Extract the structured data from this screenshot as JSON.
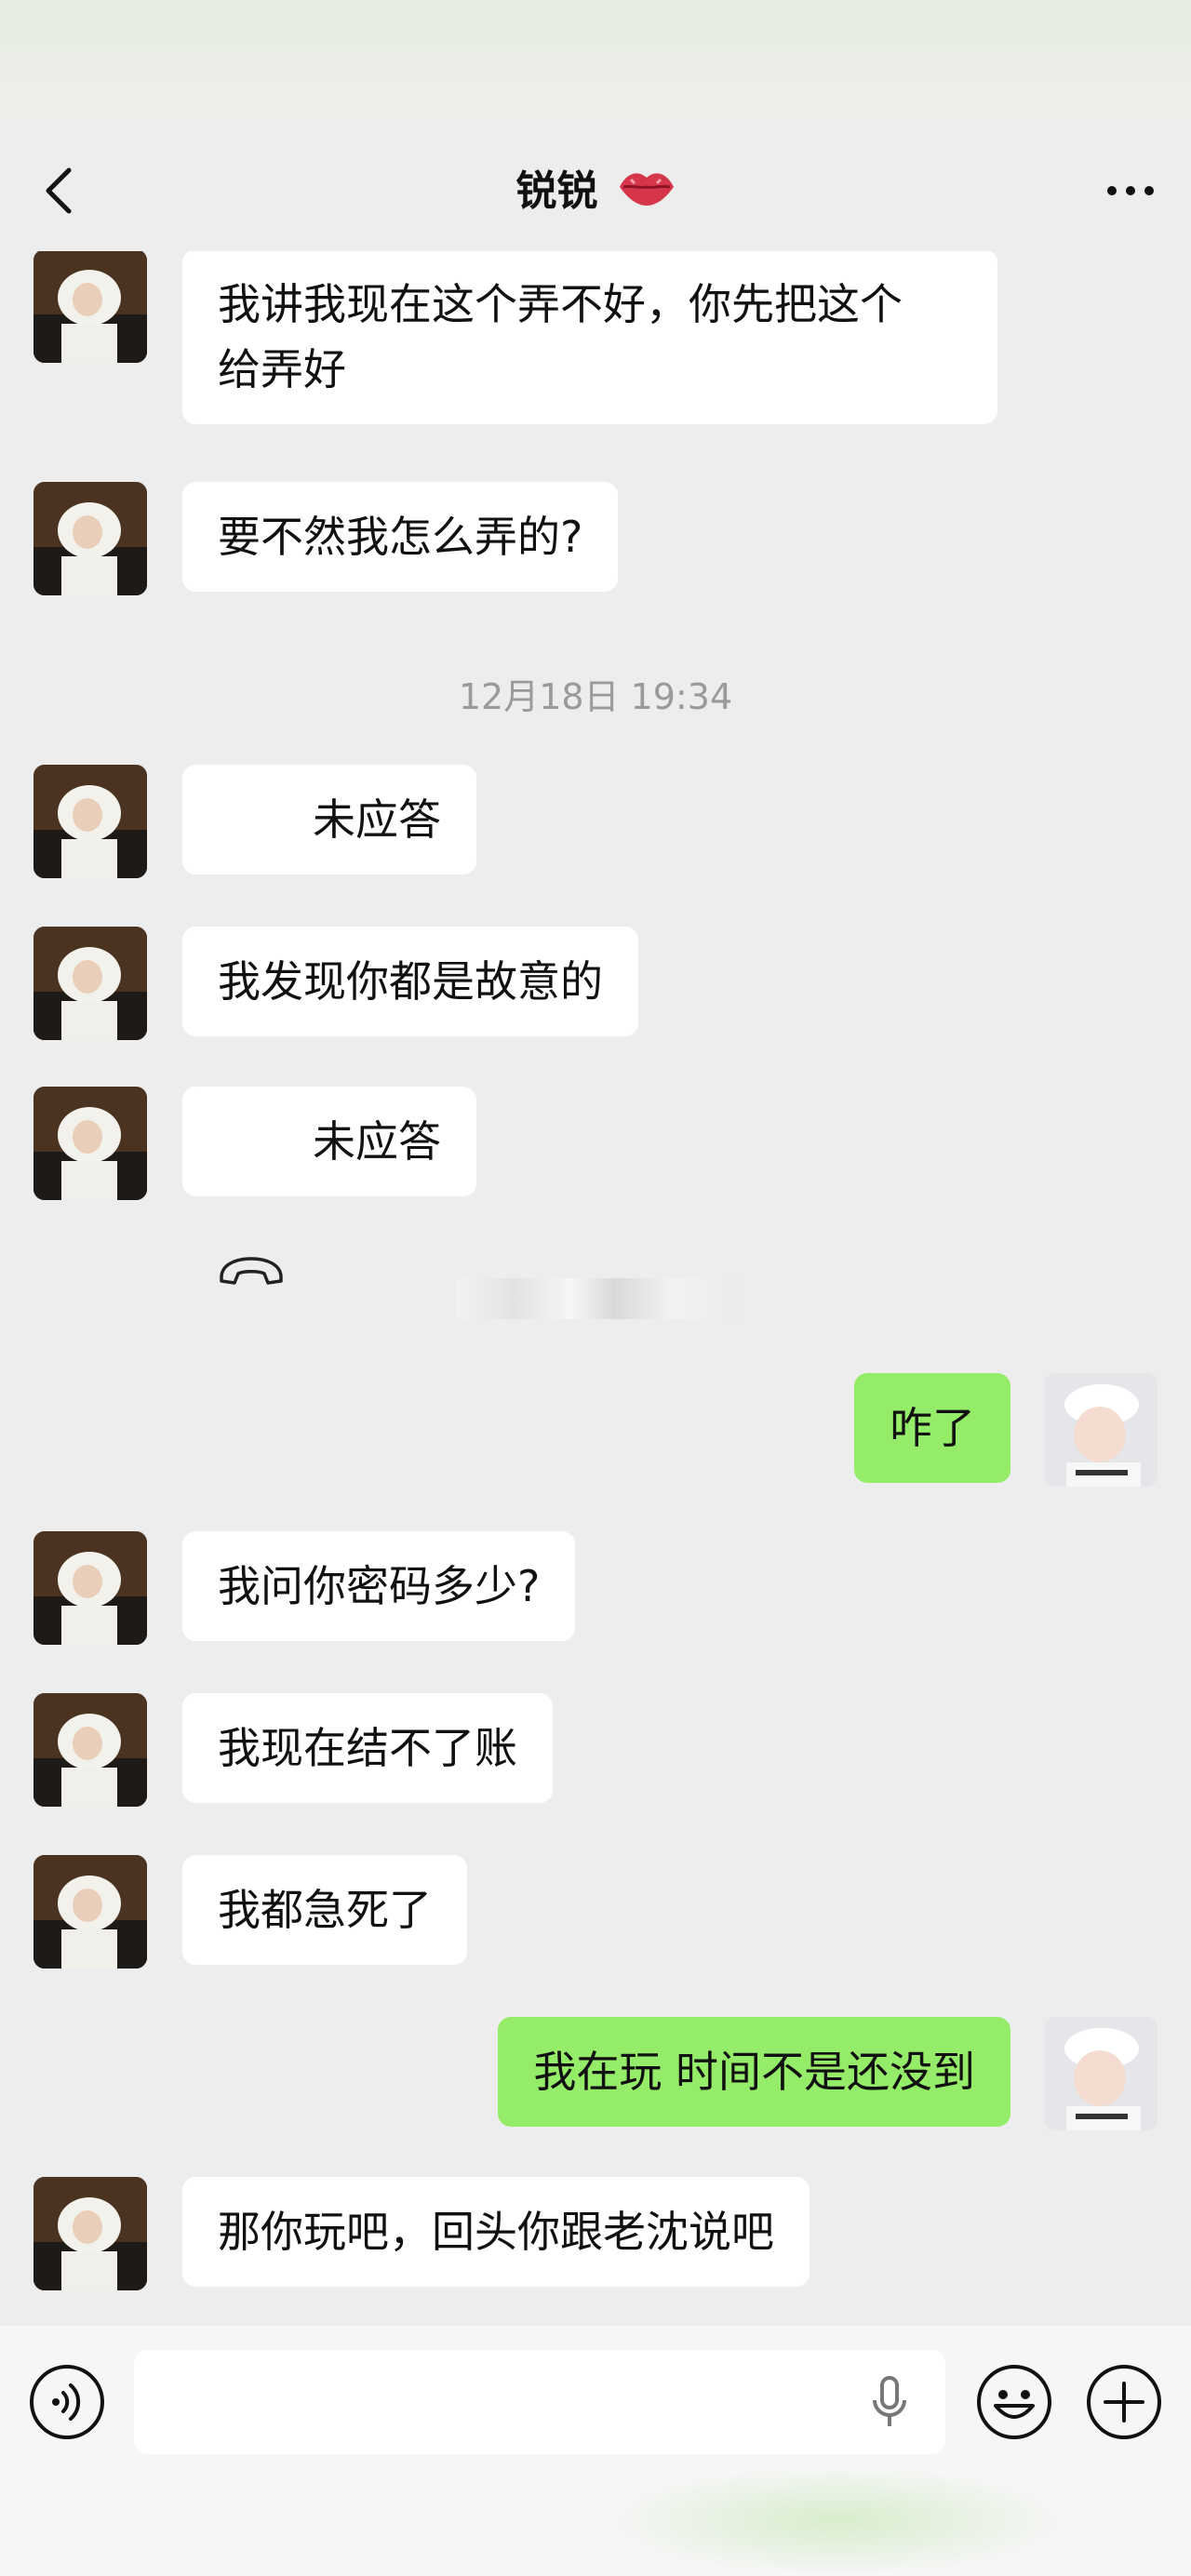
{
  "header": {
    "title": "锐锐"
  },
  "messages": [
    {
      "side": "left",
      "type": "text",
      "text": "我讲我现在这个弄不好，你先把这个\n给弄好"
    },
    {
      "side": "left",
      "type": "text",
      "text": "要不然我怎么弄的?"
    },
    {
      "type": "timestamp",
      "text": "12月18日 19:34"
    },
    {
      "side": "left",
      "type": "call",
      "text": "未应答"
    },
    {
      "side": "left",
      "type": "text",
      "text": "我发现你都是故意的"
    },
    {
      "side": "left",
      "type": "call",
      "text": "未应答"
    },
    {
      "side": "right",
      "type": "text",
      "text": "咋了"
    },
    {
      "side": "left",
      "type": "text",
      "text": "我问你密码多少?"
    },
    {
      "side": "left",
      "type": "text",
      "text": "我现在结不了账"
    },
    {
      "side": "left",
      "type": "text",
      "text": "我都急死了"
    },
    {
      "side": "right",
      "type": "text",
      "text": "我在玩 时间不是还没到"
    },
    {
      "side": "left",
      "type": "text",
      "text": "那你玩吧，回头你跟老沈说吧"
    }
  ],
  "input": {
    "value": ""
  },
  "colors": {
    "background": "#ededed",
    "bubble_left": "#ffffff",
    "bubble_right": "#95ec69"
  },
  "icons": {
    "back": "chevron-left-icon",
    "title_emoji": "lips-icon",
    "more": "more-dots-icon",
    "missed_call": "phone-hangup-icon",
    "voice": "voice-icon",
    "mic": "mic-icon",
    "emoji": "emoji-icon",
    "add": "plus-icon"
  }
}
